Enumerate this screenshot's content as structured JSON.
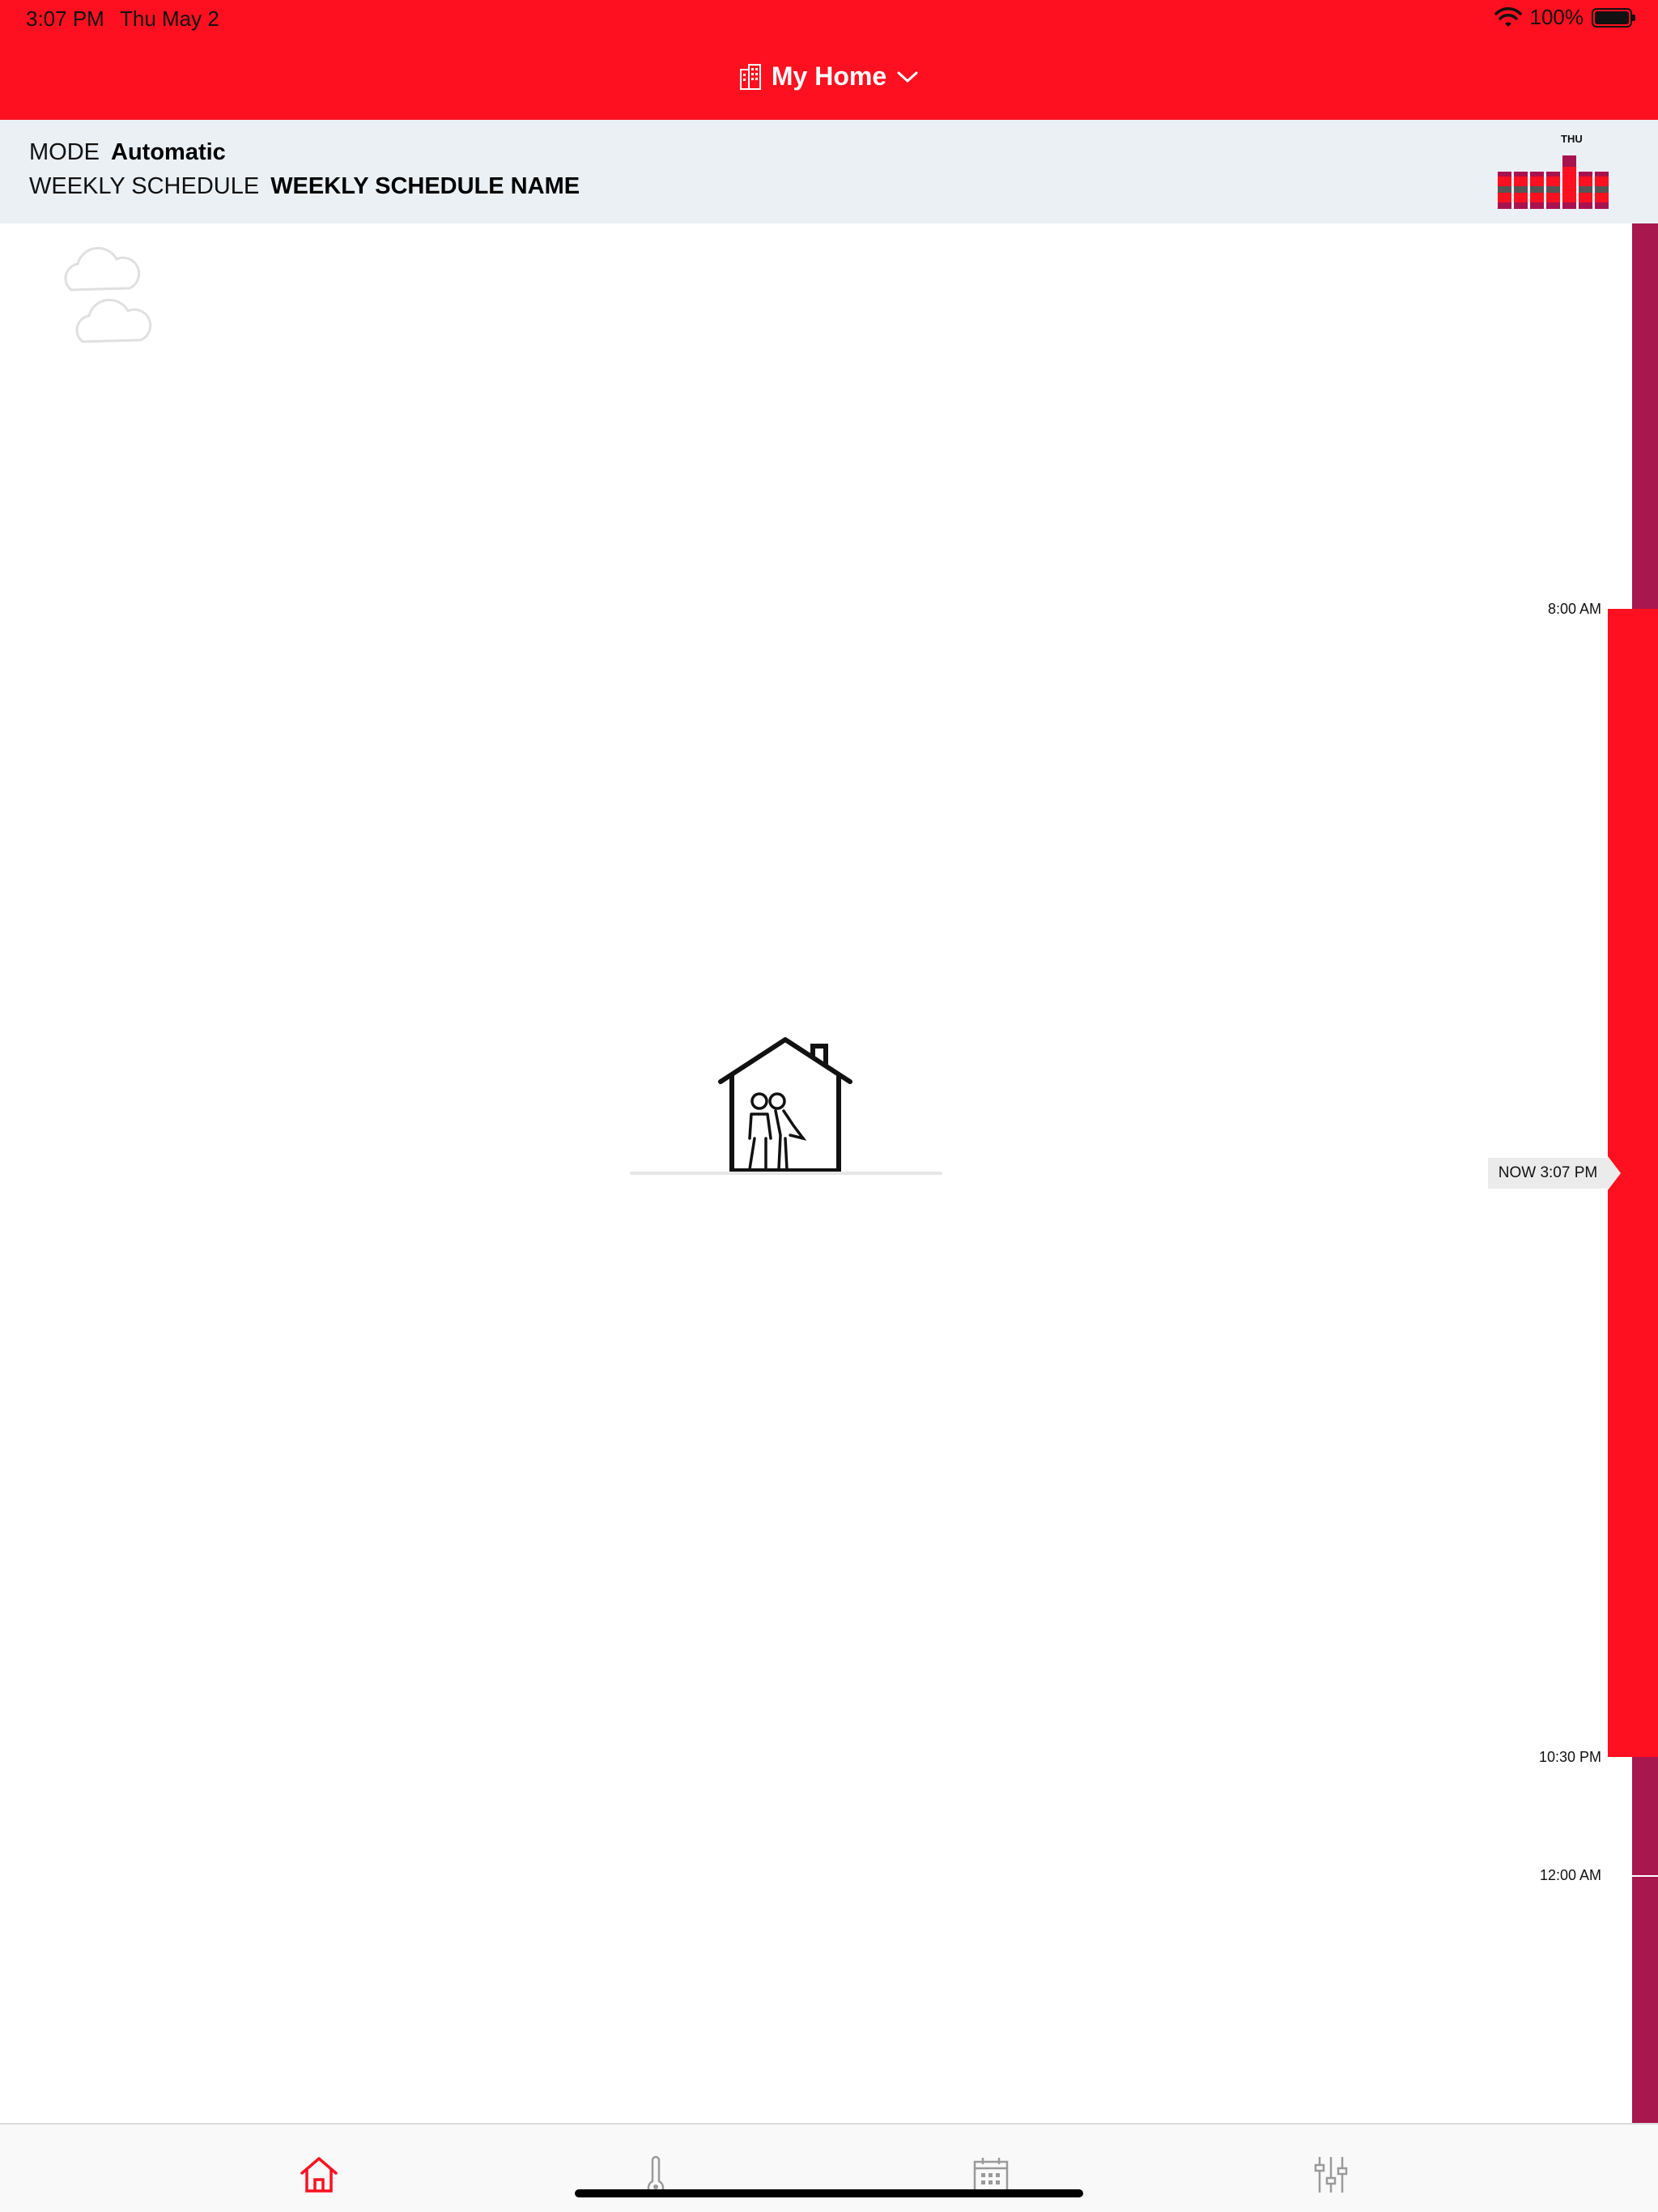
{
  "status_bar": {
    "time": "3:07 PM",
    "date": "Thu May 2",
    "battery_percent": "100%",
    "battery_level": 1.0
  },
  "header": {
    "title": "My Home",
    "building_icon": "building-icon",
    "dropdown_icon": "chevron-down-icon"
  },
  "info": {
    "mode_label": "MODE",
    "mode_value": "Automatic",
    "schedule_label": "WEEKLY SCHEDULE",
    "schedule_value": "WEEKLY SCHEDULE NAME"
  },
  "week_mini": {
    "current_day": "THU"
  },
  "timeline": {
    "labels": [
      "8:00 AM",
      "10:30 PM",
      "12:00 AM"
    ],
    "now_label": "NOW 3:07 PM"
  },
  "colors": {
    "brand_red": "#fe1020",
    "schedule_dark": "#a8174e",
    "info_bg": "#ebf0f4"
  },
  "tabs": [
    {
      "name": "home-icon",
      "active": true
    },
    {
      "name": "thermometer-icon",
      "active": false
    },
    {
      "name": "calendar-icon",
      "active": false
    },
    {
      "name": "sliders-icon",
      "active": false
    }
  ]
}
